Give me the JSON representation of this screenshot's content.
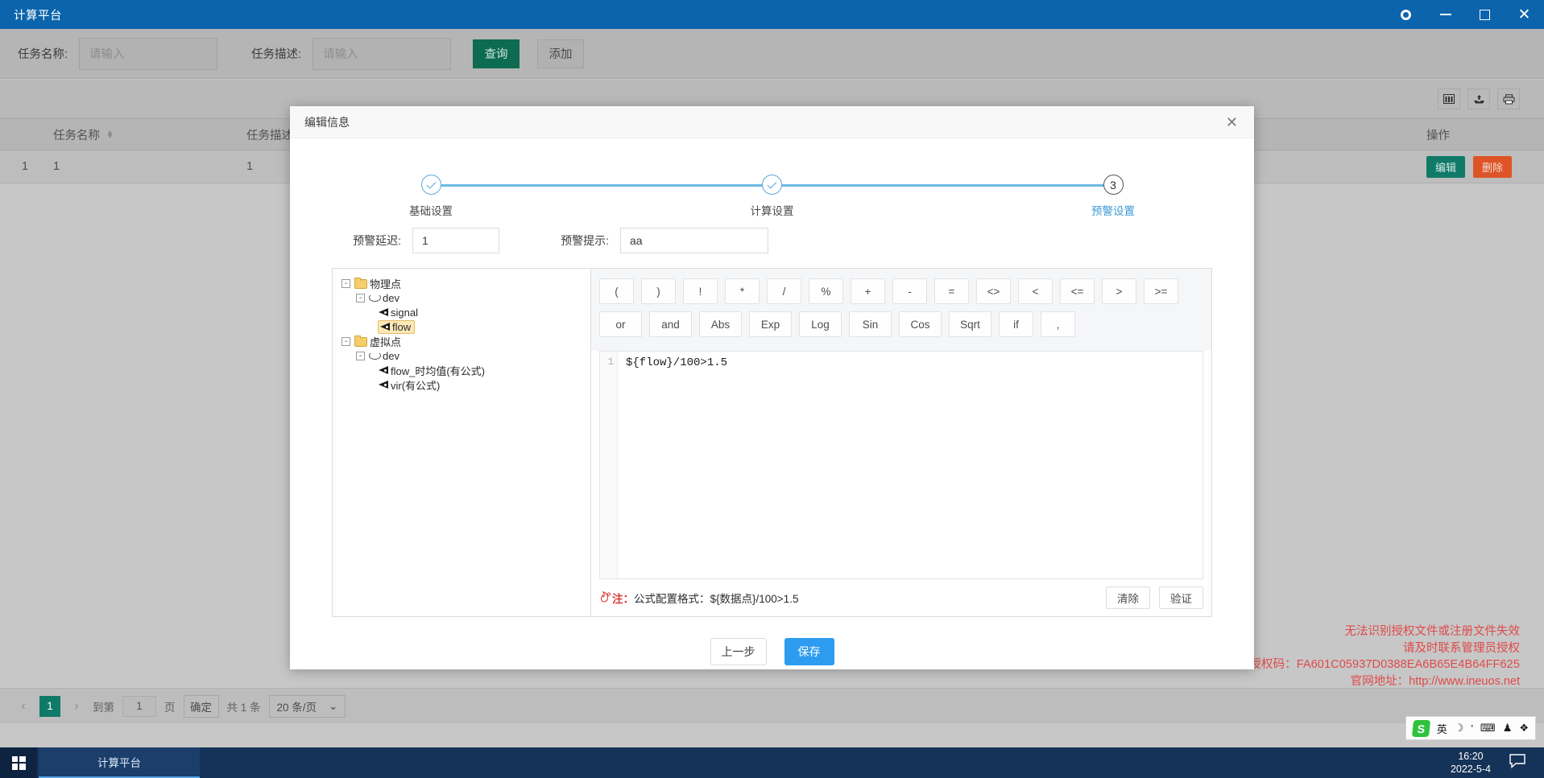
{
  "titlebar": {
    "app_title": "计算平台",
    "buttons": [
      {
        "name": "settings-icon",
        "label": ""
      },
      {
        "name": "minimize",
        "label": ""
      },
      {
        "name": "maximize",
        "label": ""
      },
      {
        "name": "close",
        "label": "✕"
      }
    ]
  },
  "searchbar": {
    "task_name_label": "任务名称:",
    "task_name_placeholder": "请输入",
    "task_desc_label": "任务描述:",
    "task_desc_placeholder": "请输入",
    "query_button": "查询",
    "add_button": "添加"
  },
  "table": {
    "toolbar_icons": [
      "columns-icon",
      "export-icon",
      "print-icon"
    ],
    "columns": [
      "",
      "任务名称",
      "任务描述",
      "操作"
    ],
    "rows": [
      {
        "index": "1",
        "name": "1",
        "desc": "1",
        "edit": "编辑",
        "delete": "删除"
      }
    ]
  },
  "pagination": {
    "prev": "‹",
    "current_page": "1",
    "next": "›",
    "goto_label": "到第",
    "goto_value": "1",
    "page_unit": "页",
    "confirm": "确定",
    "total": "共 1 条",
    "page_size": "20 条/页"
  },
  "license": {
    "line1": "无法识别授权文件或注册文件失效",
    "line2": "请及时联系管理员授权",
    "line3_label": "授权码：",
    "line3_code": "FA601C05937D0388EA6B65E4B64FF625",
    "line4": "官网地址：http://www.ineuos.net"
  },
  "modal": {
    "title": "编辑信息",
    "close_icon": "✕",
    "steps": [
      {
        "label": "基础设置",
        "state": "done",
        "marker": ""
      },
      {
        "label": "计算设置",
        "state": "done",
        "marker": ""
      },
      {
        "label": "预警设置",
        "state": "current",
        "marker": "3"
      }
    ],
    "form": {
      "delay_label": "预警延迟:",
      "delay_value": "1",
      "tip_label": "预警提示:",
      "tip_value": "aa"
    },
    "tree": [
      {
        "level": 1,
        "expander": "-",
        "icon": "folder-icon",
        "label": "物理点",
        "selected": false
      },
      {
        "level": 2,
        "expander": "-",
        "icon": "device-icon",
        "label": "dev",
        "selected": false
      },
      {
        "level": 3,
        "expander": "",
        "icon": "tag-icon",
        "label": "signal",
        "selected": false
      },
      {
        "level": 3,
        "expander": "",
        "icon": "tag-icon",
        "label": "flow",
        "selected": true
      },
      {
        "level": 1,
        "expander": "-",
        "icon": "folder-icon",
        "label": "虚拟点",
        "selected": false
      },
      {
        "level": 2,
        "expander": "-",
        "icon": "device-icon",
        "label": "dev",
        "selected": false
      },
      {
        "level": 3,
        "expander": "",
        "icon": "tag-icon",
        "label": "flow_时均值(有公式)",
        "selected": false
      },
      {
        "level": 3,
        "expander": "",
        "icon": "tag-icon",
        "label": "vir(有公式)",
        "selected": false
      }
    ],
    "operators_row1": [
      "(",
      ")",
      "!",
      "*",
      "/",
      "%",
      "+",
      "-",
      "=",
      "<>",
      "<",
      "<=",
      ">",
      ">="
    ],
    "operators_row2": [
      "or",
      "and",
      "Abs",
      "Exp",
      "Log",
      "Sin",
      "Cos",
      "Sqrt",
      "if",
      ","
    ],
    "editor": {
      "line_number": "1",
      "formula": "${flow}/100>1.5"
    },
    "note": {
      "icon": "fire-icon",
      "prefix": "注：",
      "text": "公式配置格式：${数据点}/100>1.5",
      "clear_button": "清除",
      "validate_button": "验证"
    },
    "footer": {
      "prev_button": "上一步",
      "save_button": "保存"
    }
  },
  "ime": {
    "logo": "S",
    "items": [
      "英",
      "☽",
      "'",
      "⌨",
      "♟",
      "❖"
    ]
  },
  "taskbar": {
    "start_icon": "windows-logo",
    "task_label": "计算平台",
    "time": "16:20",
    "date": "2022-5-4",
    "notification_icon": "💬"
  },
  "colors": {
    "title_blue": "#0b64ac",
    "accent_blue": "#2d9cf0",
    "step_blue": "#5aa9d8",
    "teal": "#0f7a68",
    "orange": "#dd5427",
    "green": "#0c6b50",
    "license_red": "#e04a4a"
  }
}
